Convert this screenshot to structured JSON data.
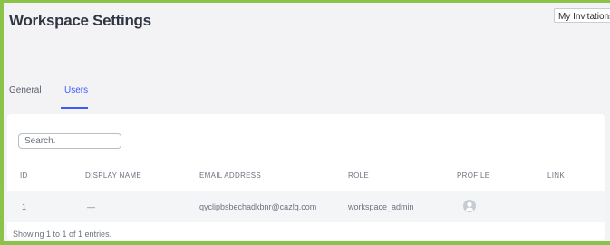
{
  "header": {
    "title": "Workspace Settings",
    "my_invitations_label": "My Invitations"
  },
  "tabs": [
    {
      "label": "General",
      "active": false
    },
    {
      "label": "Users",
      "active": true
    }
  ],
  "users_table": {
    "search_placeholder": "Search.",
    "columns": [
      "ID",
      "DISPLAY NAME",
      "EMAIL ADDRESS",
      "ROLE",
      "PROFILE",
      "LINK"
    ],
    "rows": [
      {
        "id": "1",
        "display_name": "—",
        "email": "qyclipbsbechadkbnr@cazlg.com",
        "role": "workspace_admin",
        "profile_icon": "user-avatar-icon",
        "link": ""
      }
    ],
    "footer": "Showing 1 to 1 of 1 entries."
  },
  "colors": {
    "frame": "#8bc34a",
    "accent": "#3d5afe",
    "page_bg": "#f3f3f5",
    "row_bg": "#f4f5f7"
  }
}
